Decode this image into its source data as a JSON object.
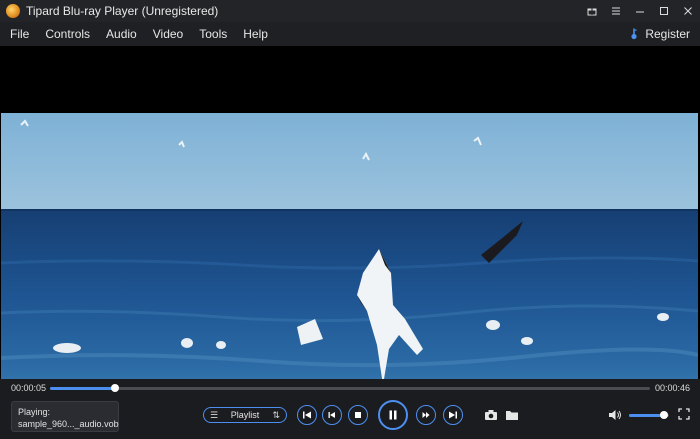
{
  "window": {
    "title": "Tipard Blu-ray Player (Unregistered)",
    "controls": {
      "settings_icon": "gift-icon",
      "menu_icon": "menu-icon",
      "minimize_icon": "minimize-icon",
      "maximize_icon": "maximize-icon",
      "close_icon": "close-icon"
    }
  },
  "menubar": {
    "items": [
      {
        "label": "File"
      },
      {
        "label": "Controls"
      },
      {
        "label": "Audio"
      },
      {
        "label": "Video"
      },
      {
        "label": "Tools"
      },
      {
        "label": "Help"
      }
    ],
    "register_label": "Register"
  },
  "player": {
    "time_current": "00:00:05",
    "time_total": "00:00:46",
    "progress_fraction": 0.109,
    "now_playing": {
      "label": "Playing:",
      "filename": "sample_960..._audio.vob"
    },
    "playlist_label": "Playlist",
    "volume_fraction": 0.87
  },
  "colors": {
    "accent": "#4d8ff0",
    "background": "#1b1c1f",
    "titlebar": "#232428",
    "sea_dark": "#1e4f86",
    "sky": "#8fb9d8"
  }
}
